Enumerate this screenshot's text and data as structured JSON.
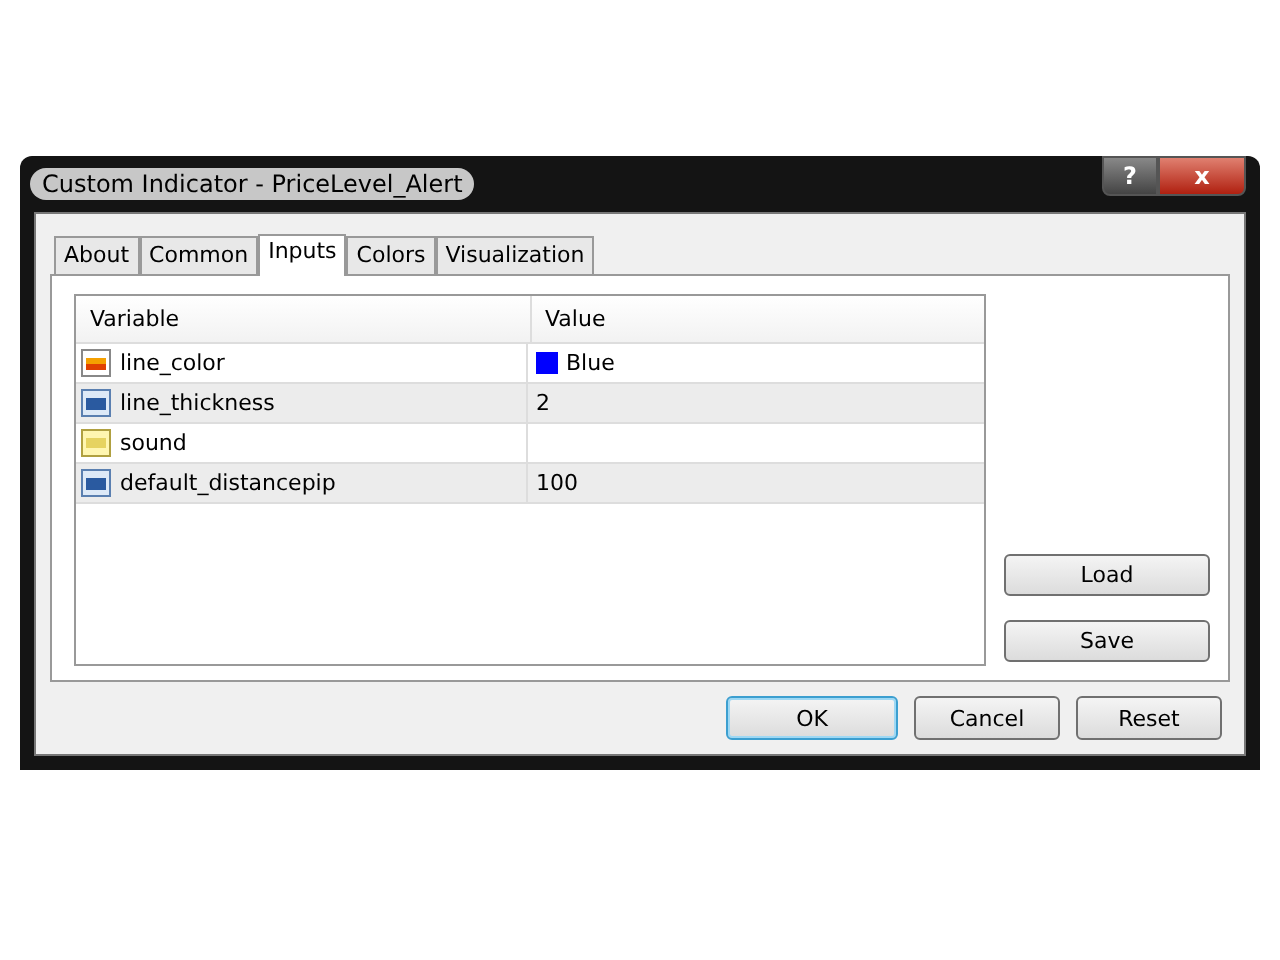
{
  "window": {
    "title": "Custom Indicator - PriceLevel_Alert",
    "help_button": "?",
    "close_button": "x"
  },
  "tabs": [
    {
      "label": "About",
      "selected": false
    },
    {
      "label": "Common",
      "selected": false
    },
    {
      "label": "Inputs",
      "selected": true
    },
    {
      "label": "Colors",
      "selected": false
    },
    {
      "label": "Visualization",
      "selected": false
    }
  ],
  "table": {
    "columns": [
      "Variable",
      "Value"
    ],
    "rows": [
      {
        "kind": "color",
        "variable": "line_color",
        "value": "Blue",
        "color": "#0000ff"
      },
      {
        "kind": "number",
        "variable": "line_thickness",
        "value": "2"
      },
      {
        "kind": "text",
        "variable": "sound",
        "value": ""
      },
      {
        "kind": "number",
        "variable": "default_distancepip",
        "value": "100"
      }
    ]
  },
  "side_buttons": [
    "Load",
    "Save"
  ],
  "buttons": [
    {
      "label": "OK",
      "default": true
    },
    {
      "label": "Cancel",
      "default": false
    },
    {
      "label": "Reset",
      "default": false
    }
  ]
}
